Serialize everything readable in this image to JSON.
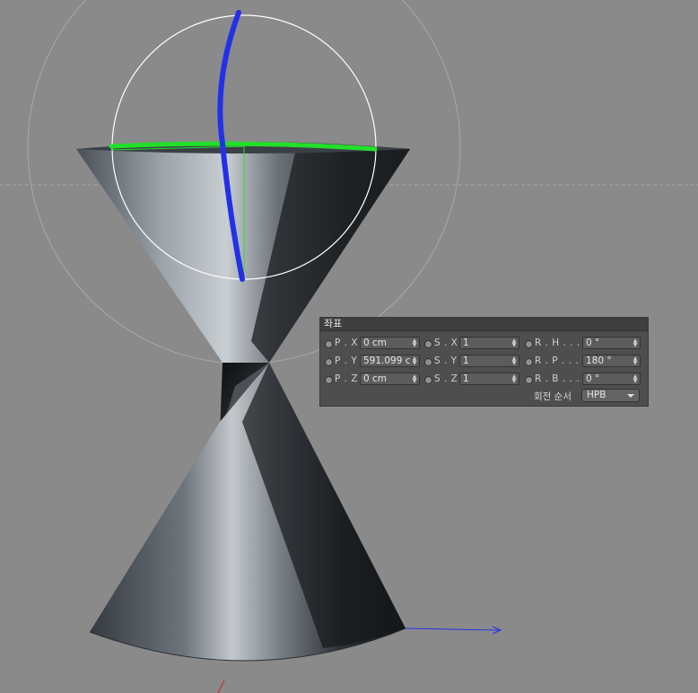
{
  "panel": {
    "title": "좌표",
    "rows": [
      {
        "p_label": "P . X",
        "p_value": "0 cm",
        "s_label": "S . X",
        "s_value": "1",
        "r_label": "R . H . . . .",
        "r_value": "0 °"
      },
      {
        "p_label": "P . Y",
        "p_value": "591.099 cm",
        "s_label": "S . Y",
        "s_value": "1",
        "r_label": "R . P . . . .",
        "r_value": "180 °"
      },
      {
        "p_label": "P . Z",
        "p_value": "0 cm",
        "s_label": "S . Z",
        "s_value": "1",
        "r_label": "R . B . . . .",
        "r_value": "0 °"
      }
    ],
    "rotation_order_label": "회전 순서",
    "rotation_order_value": "HPB"
  },
  "colors": {
    "viewport_bg": "#8a8a8a",
    "axis_green": "#22e02a",
    "axis_blue": "#2430e8",
    "axis_red": "#d02020",
    "gizmo_ring": "#ffffff"
  },
  "icons": [
    "radio-icon",
    "spinner-arrows-icon",
    "dropdown-arrow-icon"
  ]
}
